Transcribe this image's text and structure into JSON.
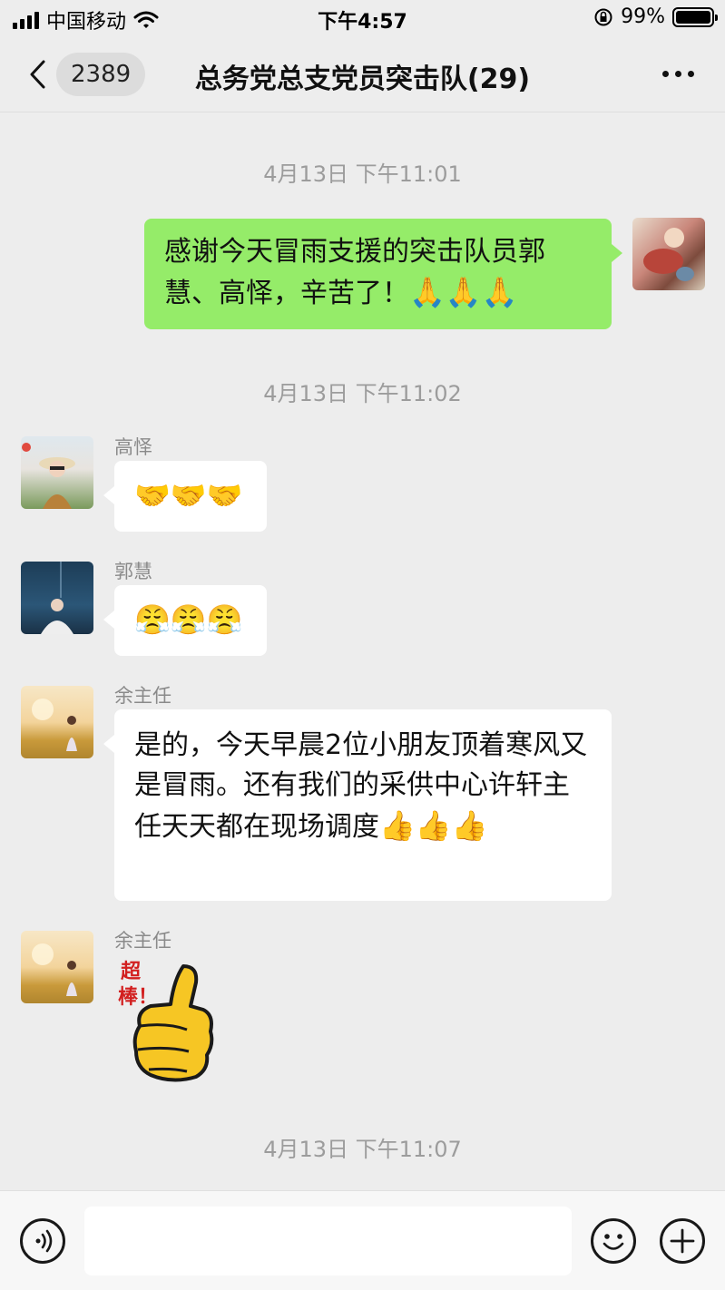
{
  "status_bar": {
    "carrier": "中国移动",
    "time": "下午4:57",
    "battery": "99%",
    "battery_level": 0.99
  },
  "nav": {
    "unread_count": "2389",
    "title": "总务党总支党员突击队(29)"
  },
  "messages": [
    {
      "type": "timestamp",
      "text": "4月13日 下午11:01"
    },
    {
      "type": "outgoing",
      "text": "感谢今天冒雨支援的突击队员郭慧、高怿，辛苦了！",
      "emojis": "🙏🙏🙏"
    },
    {
      "type": "timestamp",
      "text": "4月13日 下午11:02"
    },
    {
      "type": "incoming",
      "sender": "高怿",
      "emojis": "🤝🤝🤝"
    },
    {
      "type": "incoming",
      "sender": "郭慧",
      "emojis": "😤😤😤"
    },
    {
      "type": "incoming",
      "sender": "余主任",
      "text": "是的，今天早晨2位小朋友顶着寒风又是冒雨。还有我们的采供中心许轩主任天天都在现场调度",
      "emojis": "👍👍👍"
    },
    {
      "type": "sticker",
      "sender": "余主任",
      "sticker_text": "超棒！"
    },
    {
      "type": "timestamp",
      "text": "4月13日 下午11:07"
    }
  ],
  "input": {
    "placeholder": ""
  },
  "colors": {
    "background": "#ededed",
    "outgoing_bubble": "#95ec69",
    "incoming_bubble": "#ffffff",
    "timestamp": "#9c9c9c"
  },
  "icons": [
    "wifi-icon",
    "lock-rotation-icon",
    "back-icon",
    "more-icon",
    "voice-icon",
    "emoji-icon",
    "plus-icon"
  ]
}
